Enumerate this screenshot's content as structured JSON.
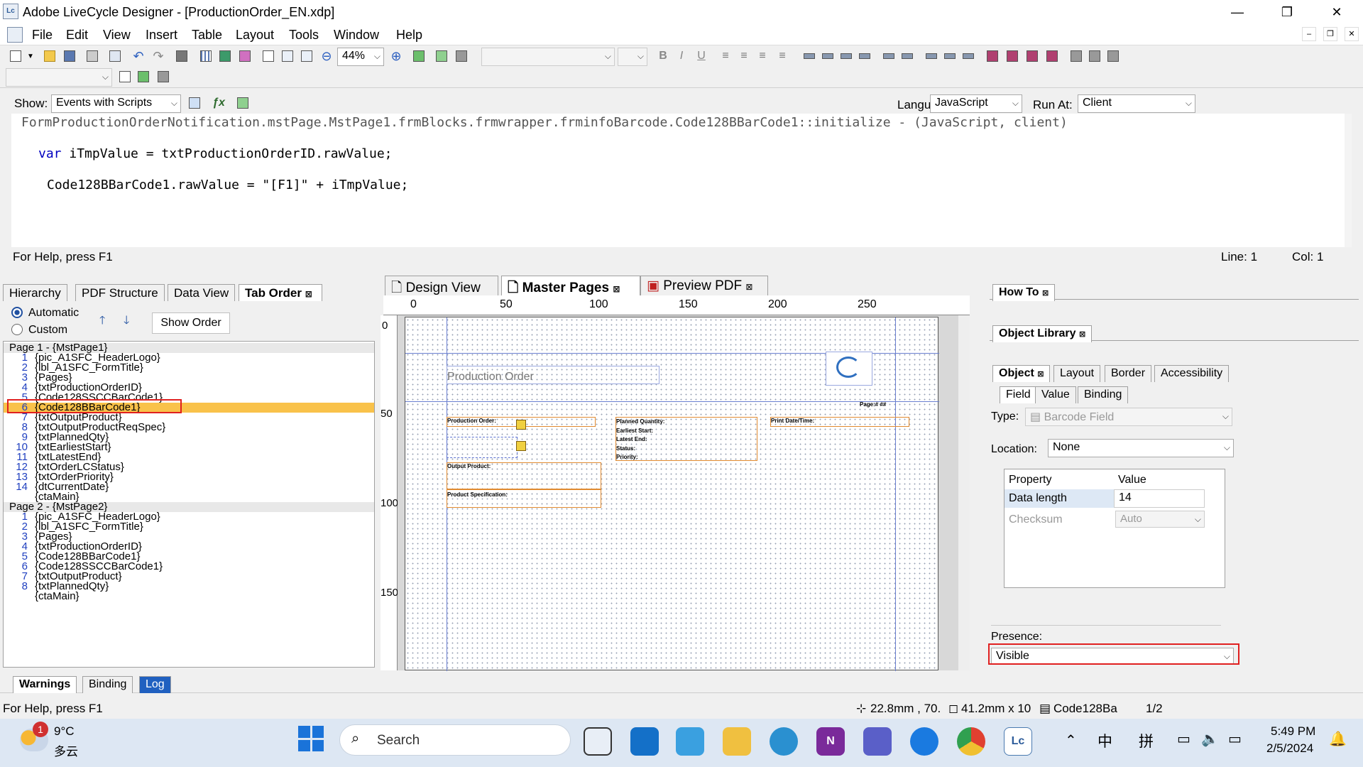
{
  "window": {
    "title": "Adobe LiveCycle Designer - [ProductionOrder_EN.xdp]",
    "app_icon": "Lc"
  },
  "menu": [
    "File",
    "Edit",
    "View",
    "Insert",
    "Table",
    "Layout",
    "Tools",
    "Window",
    "Help"
  ],
  "toolbar": {
    "zoom": "44%"
  },
  "script": {
    "show_label": "Show:",
    "show_value": "Events with Scripts",
    "language_label": "Language:",
    "language_value": "JavaScript",
    "runat_label": "Run At:",
    "runat_value": "Client",
    "header_line": "FormProductionOrderNotification.mstPage.MstPage1.frmBlocks.frmwrapper.frminfoBarcode.Code128BBarCode1::initialize - (JavaScript, client)",
    "line1_kw": "var",
    "line1_rest": " iTmpValue = txtProductionOrderID.rawValue;",
    "line2": "Code128BBarCode1.rawValue = \"[F1]\" + iTmpValue;",
    "help": "For Help, press F1",
    "line": "Line: 1",
    "col": "Col: 1"
  },
  "left_panel": {
    "tabs": [
      "Hierarchy",
      "PDF Structure",
      "Data View",
      "Tab Order"
    ],
    "radio_auto": "Automatic",
    "radio_custom": "Custom",
    "show_order": "Show Order",
    "page1_header": "Page 1 - {MstPage1}",
    "page1_items": [
      {
        "n": "1",
        "t": "{pic_A1SFC_HeaderLogo}"
      },
      {
        "n": "2",
        "t": "{lbl_A1SFC_FormTitle}"
      },
      {
        "n": "3",
        "t": "{Pages}"
      },
      {
        "n": "4",
        "t": "{txtProductionOrderID}"
      },
      {
        "n": "5",
        "t": "{Code128SSCCBarCode1}"
      },
      {
        "n": "6",
        "t": "{Code128BBarCode1}"
      },
      {
        "n": "7",
        "t": "{txtOutputProduct}"
      },
      {
        "n": "8",
        "t": "{txtOutputProductReqSpec}"
      },
      {
        "n": "9",
        "t": "{txtPlannedQty}"
      },
      {
        "n": "10",
        "t": "{txtEarliestStart}"
      },
      {
        "n": "11",
        "t": "{txtLatestEnd}"
      },
      {
        "n": "12",
        "t": "{txtOrderLCStatus}"
      },
      {
        "n": "13",
        "t": "{txtOrderPriority}"
      },
      {
        "n": "14",
        "t": "{dtCurrentDate}"
      },
      {
        "n": "",
        "t": "{ctaMain}"
      }
    ],
    "page2_header": "Page 2 - {MstPage2}",
    "page2_items": [
      {
        "n": "1",
        "t": "{pic_A1SFC_HeaderLogo}"
      },
      {
        "n": "2",
        "t": "{lbl_A1SFC_FormTitle}"
      },
      {
        "n": "3",
        "t": "{Pages}"
      },
      {
        "n": "4",
        "t": "{txtProductionOrderID}"
      },
      {
        "n": "5",
        "t": "{Code128BBarCode1}"
      },
      {
        "n": "6",
        "t": "{Code128SSCCBarCode1}"
      },
      {
        "n": "7",
        "t": "{txtOutputProduct}"
      },
      {
        "n": "8",
        "t": "{txtPlannedQty}"
      },
      {
        "n": "",
        "t": "{ctaMain}"
      }
    ]
  },
  "center": {
    "tabs": [
      "Design View",
      "Master Pages",
      "Preview PDF"
    ],
    "ruler_top": [
      "0",
      "50",
      "100",
      "150",
      "200",
      "250"
    ],
    "ruler_left": [
      "0",
      "50",
      "100",
      "150"
    ],
    "form_title": "Production Order",
    "labels": {
      "po": "Production Order:",
      "op": "Output Product:",
      "ps": "Product Specification:",
      "pq": "Planned Quantity:",
      "es": "Earliest Start:",
      "le": "Latest End:",
      "st": "Status:",
      "pr": "Priority:",
      "pd": "Print Date/Time:",
      "page": "Page:# ##"
    }
  },
  "right_panel": {
    "howto": "How To",
    "objlib": "Object Library",
    "tabs": [
      "Object",
      "Layout",
      "Border",
      "Accessibility"
    ],
    "subtabs": [
      "Field",
      "Value",
      "Binding"
    ],
    "type_label": "Type:",
    "type_value": "Barcode Field",
    "location_label": "Location:",
    "location_value": "None",
    "prop_header": "Property",
    "value_header": "Value",
    "rows": [
      {
        "p": "Data length",
        "v": "14"
      },
      {
        "p": "Checksum",
        "v": "Auto"
      }
    ],
    "presence_label": "Presence:",
    "presence_value": "Visible"
  },
  "bottom": {
    "tabs": [
      "Warnings",
      "Binding",
      "Log"
    ],
    "help": "For Help, press F1",
    "pos": "22.8mm , 70.",
    "size": "41.2mm x 10",
    "obj": "Code128Ba",
    "page": "1/2"
  },
  "taskbar": {
    "temp": "9°C",
    "weather": "多云",
    "badge": "1",
    "search": "Search",
    "time": "5:49 PM",
    "date": "2/5/2024",
    "ime1": "中",
    "ime2": "拼"
  }
}
